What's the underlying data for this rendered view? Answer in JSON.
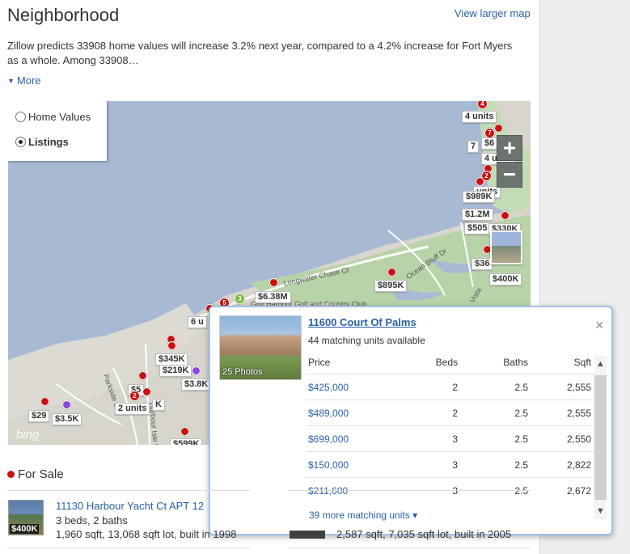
{
  "header": {
    "title": "Neighborhood",
    "view_larger_map": "View larger map"
  },
  "summary": {
    "text": "Zillow predicts 33908 home values will increase 3.2% next year, compared to a 4.2% increase for Fort Myers as a whole. Among 33908…",
    "more_label": "More"
  },
  "map": {
    "layers": {
      "home_values": "Home Values",
      "listings": "Listings",
      "selected": "Listings"
    },
    "zoom_in": "+",
    "zoom_out": "−",
    "attribution": "bing",
    "street_labels": {
      "longwater": "Longwater Chase Ct",
      "ocean_bluff": "Ocean Bluff Dr",
      "golf": "Gulf Harbour Golf and Country Club",
      "vista": "Vista",
      "parkside": "Parkside Dr",
      "harbour_isle": "Harbour Isle Dr"
    },
    "markers": {
      "t_4units_a": "4 units",
      "t_64": "$6",
      "t_7": "7",
      "t_4units_b": "4 units",
      "t_units_c": "units",
      "t_989k": "$989K",
      "t_12m": "$1.2M",
      "t_505": "$505",
      "t_330k": "$330K",
      "t_36": "$36",
      "t_400k": "$400K",
      "t_895k": "$895K",
      "t_638m": "$6.38M",
      "t_6u": "6 u",
      "t_345k": "$345K",
      "t_219k": "$219K",
      "t_38k": "$3.8K",
      "t_299": "$29",
      "t_35k": "$3.5K",
      "t_2units": "2 units",
      "t_k": "K",
      "t_59": "$5",
      "t_599k": "$599K",
      "n_4a": "4",
      "n_7": "7",
      "n_4b": "4",
      "n_2": "2",
      "n_5": "5",
      "n_2b": "2",
      "n_3": "3"
    }
  },
  "popup": {
    "photo_caption": "25 Photos",
    "title": "11600 Court Of Palms",
    "subtitle": "44 matching units available",
    "close": "×",
    "columns": {
      "price": "Price",
      "beds": "Beds",
      "baths": "Baths",
      "sqft": "Sqft"
    },
    "rows": [
      {
        "price": "$425,000",
        "beds": "2",
        "baths": "2.5",
        "sqft": "2,555"
      },
      {
        "price": "$489,000",
        "beds": "2",
        "baths": "2.5",
        "sqft": "2,555"
      },
      {
        "price": "$699,000",
        "beds": "3",
        "baths": "2.5",
        "sqft": "2,550"
      },
      {
        "price": "$150,000",
        "beds": "3",
        "baths": "2.5",
        "sqft": "2,822"
      },
      {
        "price": "$211,600",
        "beds": "3",
        "baths": "2.5",
        "sqft": "2,672"
      }
    ],
    "more_matching": "39 more matching units ▾"
  },
  "for_sale": {
    "heading": "For Sale",
    "listing1": {
      "price_badge": "$400K",
      "title": "11130 Harbour Yacht Ct APT 12",
      "beds_baths": "3 beds, 2 baths",
      "details": "1,960 sqft, 13,068 sqft lot, built in 1998"
    },
    "listing2": {
      "details": "2,587 sqft, 7,035 sqft lot, built in 2005"
    }
  },
  "colors": {
    "link": "#2a5fa8",
    "water": "#a8b9d4",
    "pin_red": "#cc1111",
    "pin_purple": "#8844dd",
    "popup_border": "#9fc1e8"
  }
}
